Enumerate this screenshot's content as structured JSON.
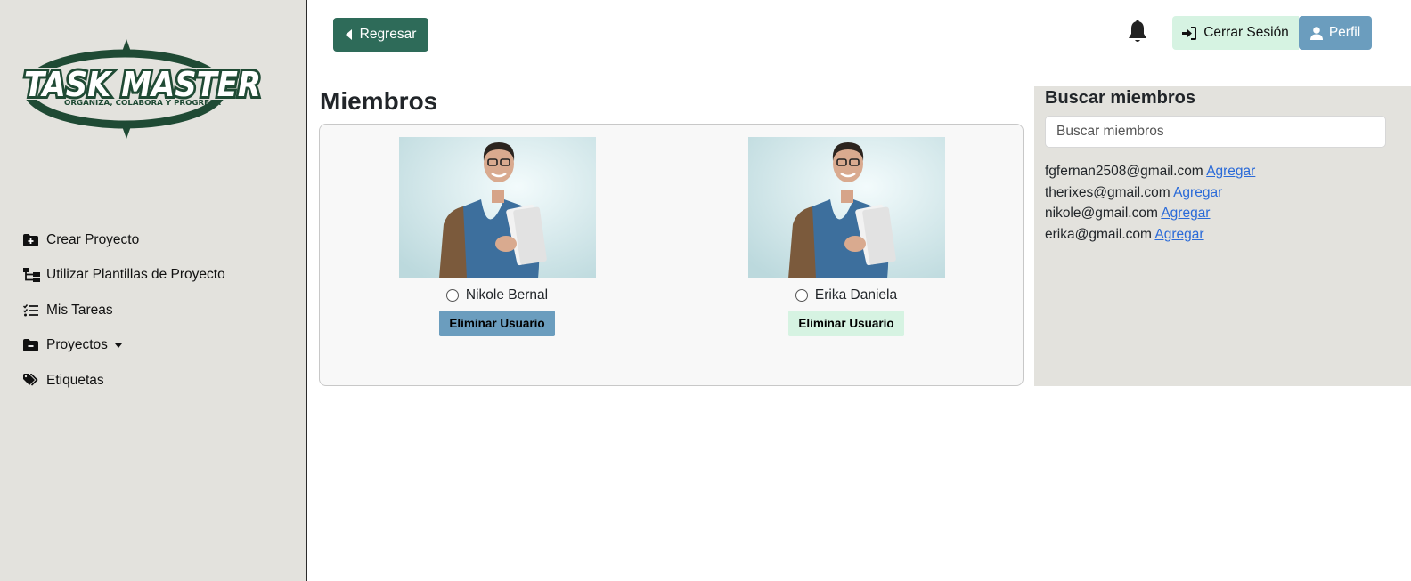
{
  "app": {
    "logo_text": "TASK MASTER",
    "logo_tagline": "ORGANIZA, COLABORA Y PROGRESA",
    "logo_color": "#1f4a34"
  },
  "sidebar": {
    "items": [
      {
        "label": "Crear Proyecto",
        "icon": "folder-plus-icon"
      },
      {
        "label": "Utilizar Plantillas de Proyecto",
        "icon": "sitemap-icon"
      },
      {
        "label": "Mis Tareas",
        "icon": "list-check-icon"
      },
      {
        "label": "Proyectos",
        "icon": "folder-minus-icon",
        "dropdown": true
      },
      {
        "label": "Etiquetas",
        "icon": "tags-icon"
      }
    ]
  },
  "header": {
    "back_label": "Regresar",
    "logout_label": "Cerrar Sesión",
    "profile_label": "Perfil"
  },
  "main": {
    "title": "Miembros",
    "members": [
      {
        "name": "Nikole Bernal",
        "delete_label": "Eliminar Usuario",
        "button_color": "#6b9dbe"
      },
      {
        "name": "Erika Daniela",
        "delete_label": "Eliminar Usuario",
        "button_color": "#d6f3e2"
      }
    ]
  },
  "search": {
    "title": "Buscar miembros",
    "placeholder": "Buscar miembros",
    "results": [
      {
        "email": "fgfernan2508@gmail.com",
        "action": "Agregar"
      },
      {
        "email": "therixes@gmail.com",
        "action": "Agregar"
      },
      {
        "email": "nikole@gmail.com",
        "action": "Agregar"
      },
      {
        "email": "erika@gmail.com",
        "action": "Agregar"
      }
    ]
  }
}
